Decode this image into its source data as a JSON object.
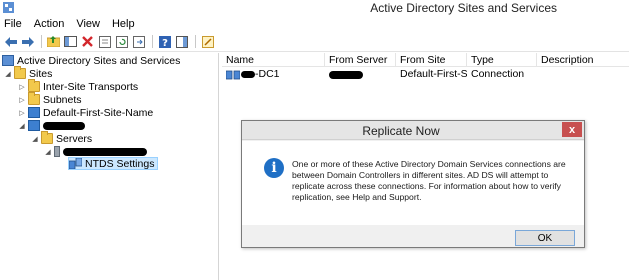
{
  "window": {
    "title": "Active Directory Sites and Services"
  },
  "menu": [
    "File",
    "Action",
    "View",
    "Help"
  ],
  "toolbar": {
    "buttons": [
      {
        "icon": "back-arrow-icon"
      },
      {
        "icon": "forward-arrow-icon"
      },
      {
        "icon": "up-folder-icon"
      },
      {
        "icon": "show-hide-tree-icon"
      },
      {
        "icon": "delete-icon"
      },
      {
        "icon": "properties-icon"
      },
      {
        "icon": "refresh-icon"
      },
      {
        "icon": "export-list-icon"
      },
      {
        "icon": "help-icon"
      },
      {
        "icon": "action-pane-icon"
      },
      {
        "icon": "run-icon"
      }
    ]
  },
  "tree": {
    "root": "Active Directory Sites and Services",
    "sites": "Sites",
    "inter_site": "Inter-Site Transports",
    "subnets": "Subnets",
    "default_site": "Default-First-Site-Name",
    "servers": "Servers",
    "ntds": "NTDS Settings"
  },
  "list": {
    "columns": [
      "Name",
      "From Server",
      "From Site",
      "Type",
      "Description"
    ],
    "rows": [
      {
        "name_suffix": "-DC1",
        "from_server": "",
        "from_site": "Default-First-Si...",
        "type": "Connection",
        "description": ""
      }
    ]
  },
  "dialog": {
    "title": "Replicate Now",
    "close": "x",
    "message": "One or more of these Active Directory Domain Services connections are between Domain Controllers in different sites. AD DS will attempt to replicate across these connections. For information about how to verify replication, see Help and Support.",
    "ok": "OK"
  },
  "colors": {
    "close_button": "#c75050",
    "info_icon": "#1f6fc5",
    "selection": "#cce8ff",
    "folder": "#f2c94c"
  }
}
